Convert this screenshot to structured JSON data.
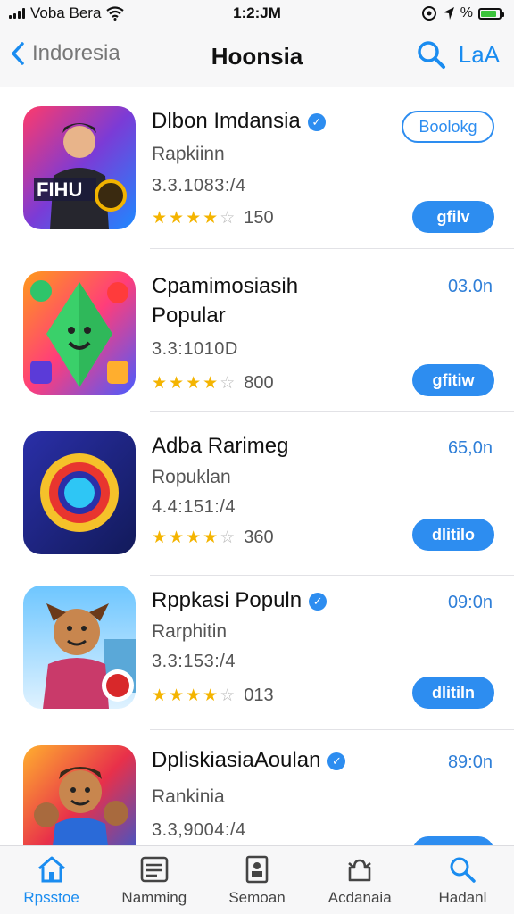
{
  "status": {
    "carrier": "Voba Bera",
    "time": "1:2:JM"
  },
  "nav": {
    "back_label": "Indoresia",
    "title": "Hoonsia",
    "right_label": "LaA"
  },
  "apps": [
    {
      "name": "Dlbon Imdansia",
      "verified": true,
      "subtitle": "Rapkiinn",
      "version": "3.3.1083:/4",
      "rating_count": "150",
      "size": "",
      "outline_button": "Boolokg",
      "action_button": "gfilv"
    },
    {
      "name": "Cpamimosiasih",
      "verified": false,
      "subtitle": "Popular",
      "version": "3.3:1010D",
      "rating_count": "800",
      "size": "03.0n",
      "outline_button": "",
      "action_button": "gfitiw"
    },
    {
      "name": "Adba Rarimeg",
      "verified": false,
      "subtitle": "Ropuklan",
      "version": "4.4:151:/4",
      "rating_count": "360",
      "size": "65,0n",
      "outline_button": "",
      "action_button": "dlitilo"
    },
    {
      "name": "Rppkasi Populn",
      "verified": true,
      "subtitle": "Rarphitin",
      "version": "3.3:153:/4",
      "rating_count": "013",
      "size": "09:0n",
      "outline_button": "",
      "action_button": "dlitiln"
    },
    {
      "name": "DpliskiasiaAoulan",
      "verified": true,
      "subtitle": "Rankinia",
      "version": "3.3,9004:/4",
      "rating_count": "",
      "size": "89:0n",
      "outline_button": "",
      "action_button": ""
    }
  ],
  "rating_level": 4.5,
  "tabs": [
    {
      "label": "Rpsstoe",
      "icon": "home-icon",
      "active": true
    },
    {
      "label": "Namming",
      "icon": "list-icon",
      "active": false
    },
    {
      "label": "Semoan",
      "icon": "document-icon",
      "active": false
    },
    {
      "label": "Acdanaia",
      "icon": "puzzle-icon",
      "active": false
    },
    {
      "label": "Hadanl",
      "icon": "search-icon",
      "active": false
    }
  ],
  "colors": {
    "accent": "#2d8df0",
    "star": "#f4b400",
    "battery": "#3cc43c"
  }
}
